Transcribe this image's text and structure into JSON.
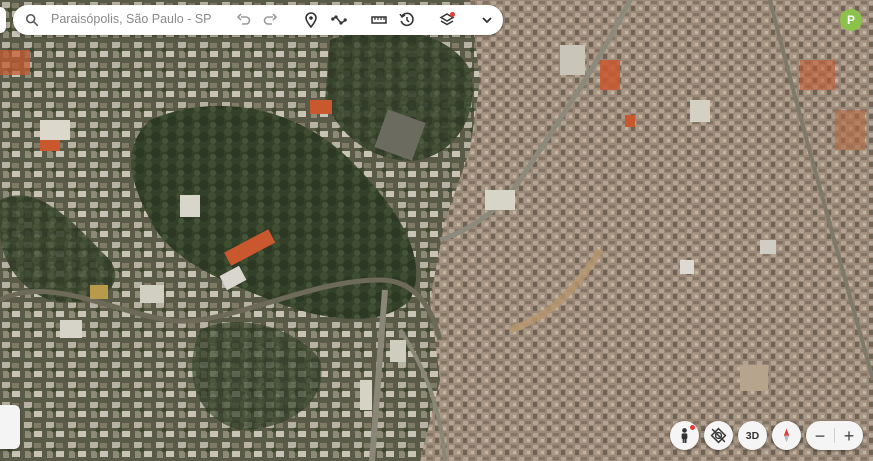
{
  "search": {
    "icon": "search-icon",
    "text": "Paraisópolis, São Paulo - SP"
  },
  "toolbar": {
    "buttons": [
      {
        "name": "undo",
        "icon": "undo-icon"
      },
      {
        "name": "redo",
        "icon": "redo-icon"
      },
      {
        "name": "placemark",
        "icon": "location-pin-icon"
      },
      {
        "name": "path",
        "icon": "path-icon"
      },
      {
        "name": "measure",
        "icon": "ruler-icon"
      },
      {
        "name": "history",
        "icon": "history-icon"
      },
      {
        "name": "layers",
        "icon": "layers-icon"
      },
      {
        "name": "expand",
        "icon": "chevron-down-icon"
      }
    ]
  },
  "user": {
    "initial": "P",
    "color": "#8bc34a"
  },
  "map_controls": {
    "street_view_icon": "pegman-icon",
    "reset_tilt_icon": "no-tilt-icon",
    "mode_3d_label": "3D",
    "compass_icon": "compass-icon",
    "zoom_out_label": "−",
    "zoom_in_label": "+"
  },
  "colors": {
    "accent": "#e53935",
    "avatar": "#8bc34a",
    "vegetation": "#3b4a2c",
    "favela": "#a08f7d",
    "roof_orange": "#c9582e"
  }
}
